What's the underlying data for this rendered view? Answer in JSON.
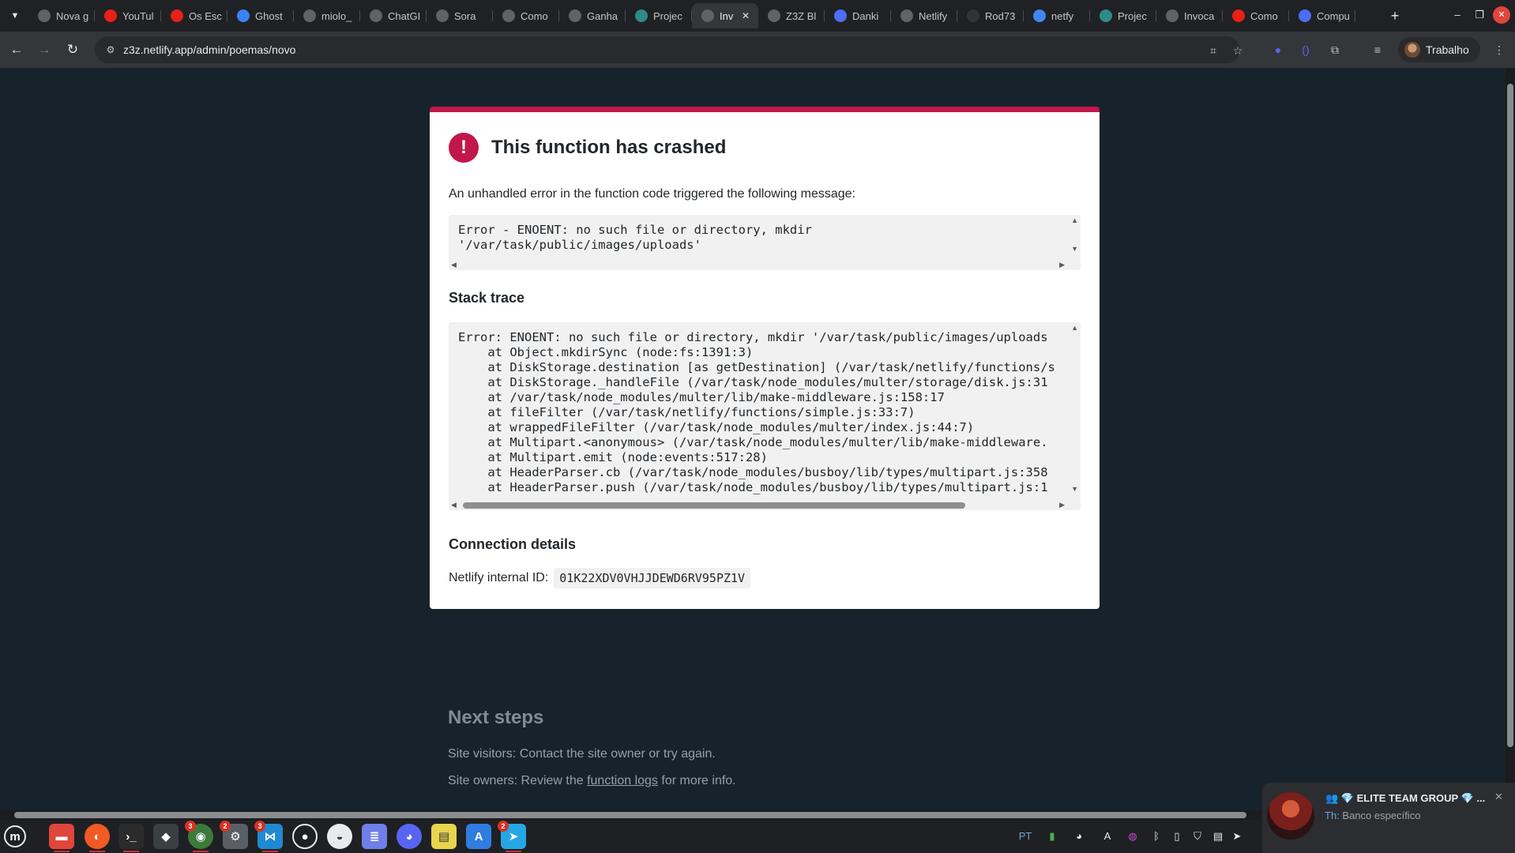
{
  "browser": {
    "tabs": [
      {
        "label": "Nova g",
        "icon": "globe-icon",
        "color": "#5f6368"
      },
      {
        "label": "YouTul",
        "icon": "youtube-icon",
        "color": "#e62117"
      },
      {
        "label": "Os Esc",
        "icon": "youtube-icon",
        "color": "#e62117"
      },
      {
        "label": "Ghost",
        "icon": "ghost-icon",
        "color": "#3b82f6"
      },
      {
        "label": "miolo_",
        "icon": "globe-icon",
        "color": "#5f6368"
      },
      {
        "label": "ChatGI",
        "icon": "openai-icon",
        "color": "#5f6368"
      },
      {
        "label": "Sora",
        "icon": "sora-icon",
        "color": "#5f6368"
      },
      {
        "label": "Como",
        "icon": "openai-icon",
        "color": "#5f6368"
      },
      {
        "label": "Ganha",
        "icon": "openai-icon",
        "color": "#5f6368"
      },
      {
        "label": "Projec",
        "icon": "diamond-icon",
        "color": "#2e8b87"
      },
      {
        "label": "Inv",
        "icon": "globe-icon",
        "color": "#5f6368",
        "active": true
      },
      {
        "label": "Z3Z Bl",
        "icon": "globe-icon",
        "color": "#5f6368"
      },
      {
        "label": "Danki",
        "icon": "code-icon",
        "color": "#4c6ef5"
      },
      {
        "label": "Netlify",
        "icon": "openai-icon",
        "color": "#5f6368"
      },
      {
        "label": "Rod73",
        "icon": "github-icon",
        "color": "#333333"
      },
      {
        "label": "netfy",
        "icon": "google-icon",
        "color": "#4285f4"
      },
      {
        "label": "Projec",
        "icon": "diamond-icon",
        "color": "#2e8b87"
      },
      {
        "label": "Invoca",
        "icon": "globe-icon",
        "color": "#5f6368"
      },
      {
        "label": "Como",
        "icon": "youtube-icon",
        "color": "#e62117"
      },
      {
        "label": "Compu",
        "icon": "gift-icon",
        "color": "#4c6ef5"
      }
    ],
    "url": "z3z.netlify.app/admin/poemas/novo",
    "profile_name": "Trabalho"
  },
  "error_page": {
    "title": "This function has crashed",
    "intro": "An unhandled error in the function code triggered the following message:",
    "error_message": "Error - ENOENT: no such file or directory, mkdir\n'/var/task/public/images/uploads'",
    "stack_trace_title": "Stack trace",
    "stack_trace": "Error: ENOENT: no such file or directory, mkdir '/var/task/public/images/uploads\n    at Object.mkdirSync (node:fs:1391:3)\n    at DiskStorage.destination [as getDestination] (/var/task/netlify/functions/s\n    at DiskStorage._handleFile (/var/task/node_modules/multer/storage/disk.js:31\n    at /var/task/node_modules/multer/lib/make-middleware.js:158:17\n    at fileFilter (/var/task/netlify/functions/simple.js:33:7)\n    at wrappedFileFilter (/var/task/node_modules/multer/index.js:44:7)\n    at Multipart.<anonymous> (/var/task/node_modules/multer/lib/make-middleware.\n    at Multipart.emit (node:events:517:28)\n    at HeaderParser.cb (/var/task/node_modules/busboy/lib/types/multipart.js:358\n    at HeaderParser.push (/var/task/node_modules/busboy/lib/types/multipart.js:1",
    "connection_title": "Connection details",
    "internal_id_label": "Netlify internal ID:",
    "internal_id": "01K22XDV0VHJJDEWD6RV95PZ1V",
    "next_steps_title": "Next steps",
    "visitors_text": "Site visitors: Contact the site owner or try again.",
    "owners_prefix": "Site owners: Review the ",
    "owners_link": "function logs",
    "owners_suffix": " for more info."
  },
  "taskbar": {
    "badges": {
      "chrome": "3",
      "mintupdate": "2",
      "vscode": "3",
      "telegram": "2"
    },
    "language": "PT"
  },
  "notification": {
    "title": "💎 ELITE TEAM GROUP 💎 ...",
    "sender": "Th:",
    "message": "Banco específico"
  },
  "colors": {
    "page_bg": "#17232c",
    "accent": "#c1174a",
    "card_bg": "#ffffff"
  }
}
